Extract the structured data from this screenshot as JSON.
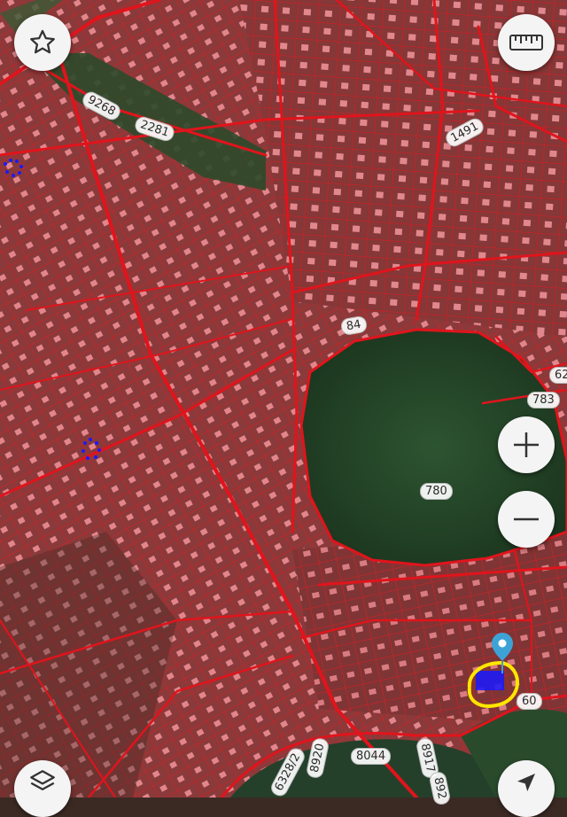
{
  "map": {
    "parcel_labels": [
      "9268",
      "2281",
      "1491",
      "84",
      "783",
      "62",
      "780",
      "60",
      "6328/2",
      "8920",
      "8044",
      "8917",
      "892"
    ],
    "colors": {
      "parcel_fill": "#8a3838",
      "parcel_border": "#e0141c",
      "forest": "#1f3f22",
      "selection_ring": "#ffe600",
      "marker": "#3da3d6",
      "dot": "#1a1aff"
    }
  },
  "controls": {
    "favorite": "star-icon",
    "measure": "ruler-icon",
    "zoom_in": "plus-icon",
    "zoom_out": "minus-icon",
    "layers": "layers-icon",
    "locate": "navigation-arrow-icon"
  }
}
